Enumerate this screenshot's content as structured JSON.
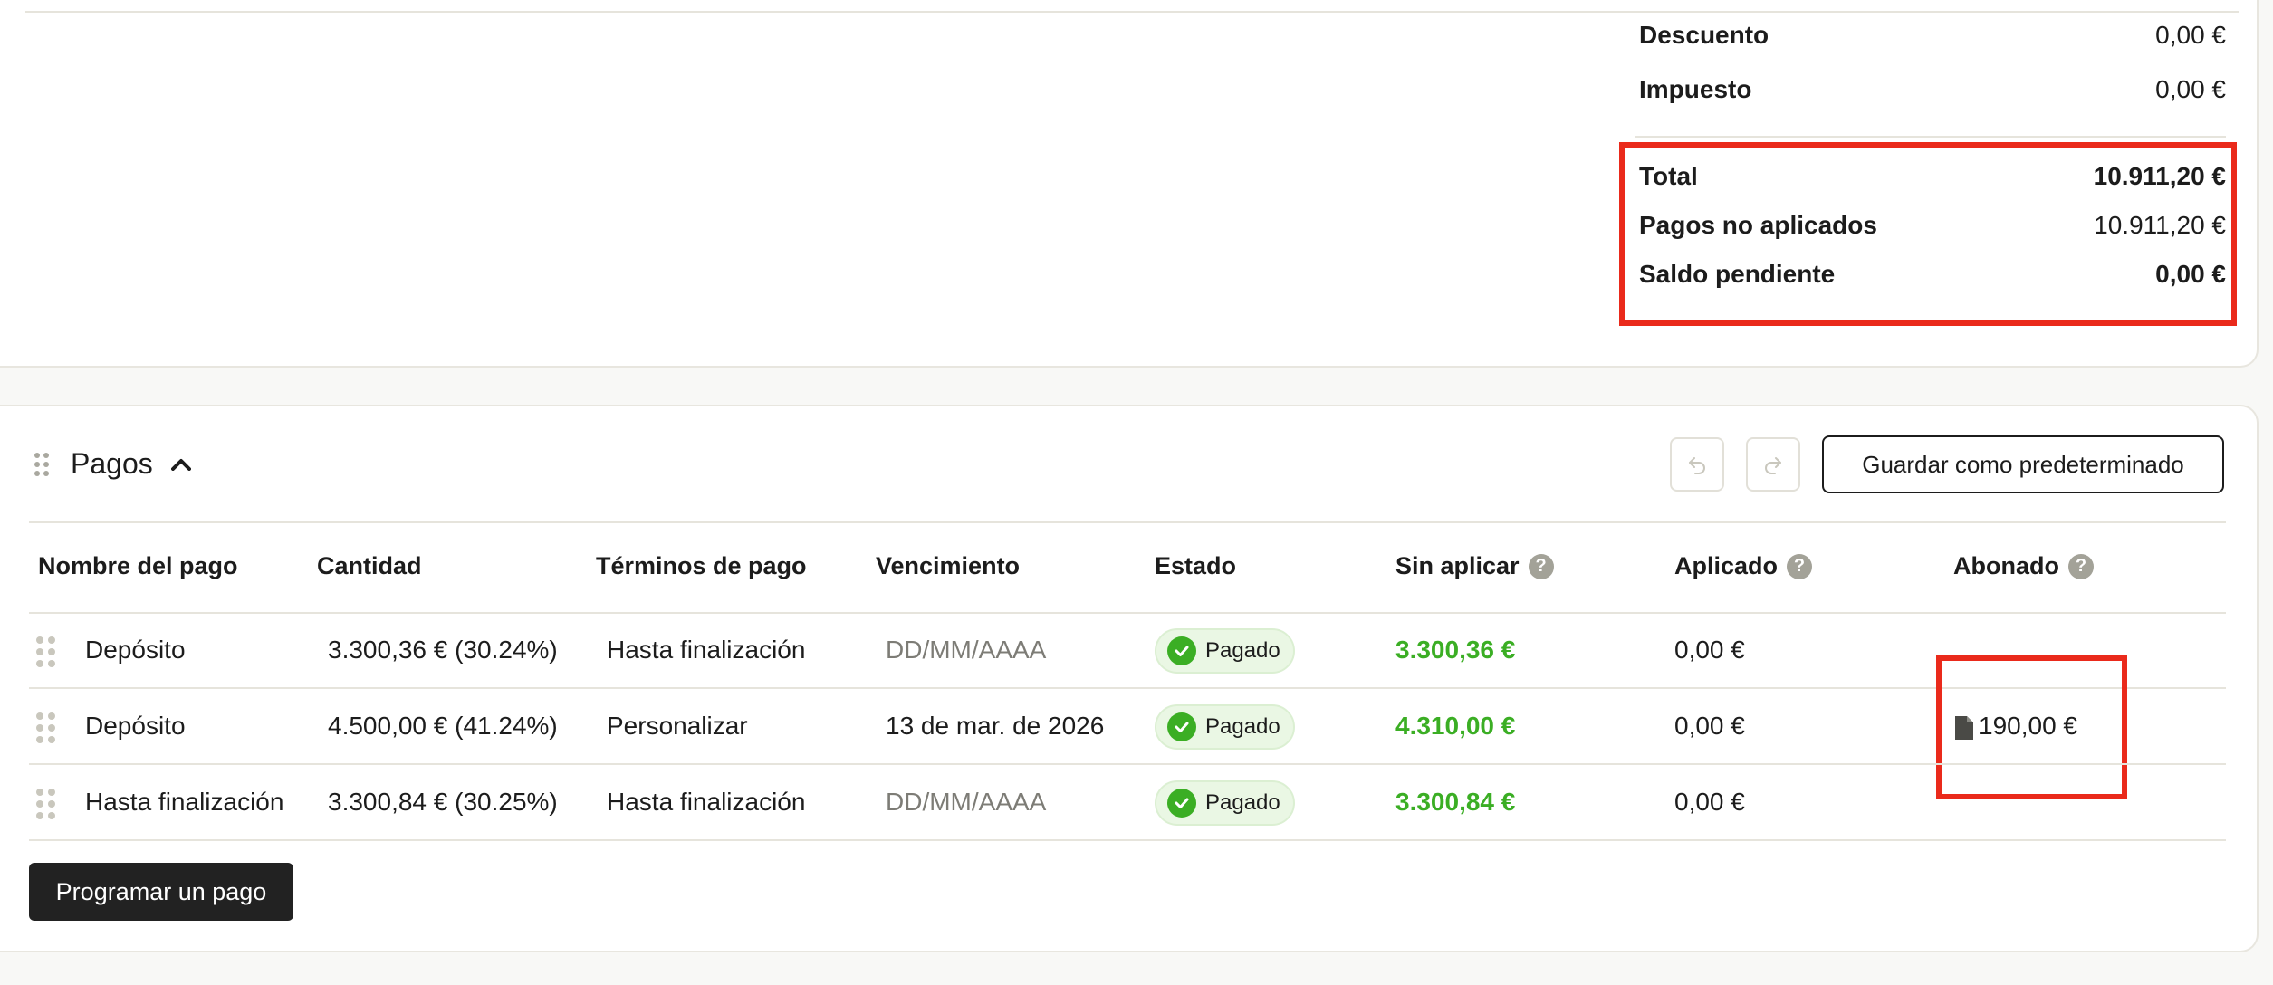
{
  "summary": {
    "rows": [
      {
        "label": "Descuento",
        "value": "0,00 €"
      },
      {
        "label": "Impuesto",
        "value": "0,00 €"
      },
      {
        "label": "Total",
        "value": "10.911,20 €"
      },
      {
        "label": "Pagos no aplicados",
        "value": "10.911,20 €"
      },
      {
        "label": "Saldo pendiente",
        "value": "0,00 €"
      }
    ]
  },
  "payments": {
    "title": "Pagos",
    "save_default_label": "Guardar como predeterminado",
    "schedule_button_label": "Programar un pago",
    "columns": {
      "name": "Nombre del pago",
      "amount": "Cantidad",
      "terms": "Términos de pago",
      "due": "Vencimiento",
      "status": "Estado",
      "unapplied": "Sin aplicar",
      "applied": "Aplicado",
      "credited": "Abonado"
    },
    "rows": [
      {
        "name": "Depósito",
        "amount": "3.300,36 € (30.24%)",
        "terms": "Hasta finalización",
        "due": "DD/MM/AAAA",
        "status": "Pagado",
        "unapplied": "3.300,36 €",
        "applied": "0,00 €",
        "credited": ""
      },
      {
        "name": "Depósito",
        "amount": "4.500,00 € (41.24%)",
        "terms": "Personalizar",
        "due": "13 de mar. de 2026",
        "status": "Pagado",
        "unapplied": "4.310,00 €",
        "applied": "0,00 €",
        "credited": "190,00 €"
      },
      {
        "name": "Hasta finalización",
        "amount": "3.300,84 € (30.25%)",
        "terms": "Hasta finalización",
        "due": "DD/MM/AAAA",
        "status": "Pagado",
        "unapplied": "3.300,84 €",
        "applied": "0,00 €",
        "credited": ""
      }
    ]
  },
  "colors": {
    "highlight": "#ea2a1b",
    "paid_green": "#3bae24",
    "primary_button": "#222222"
  }
}
